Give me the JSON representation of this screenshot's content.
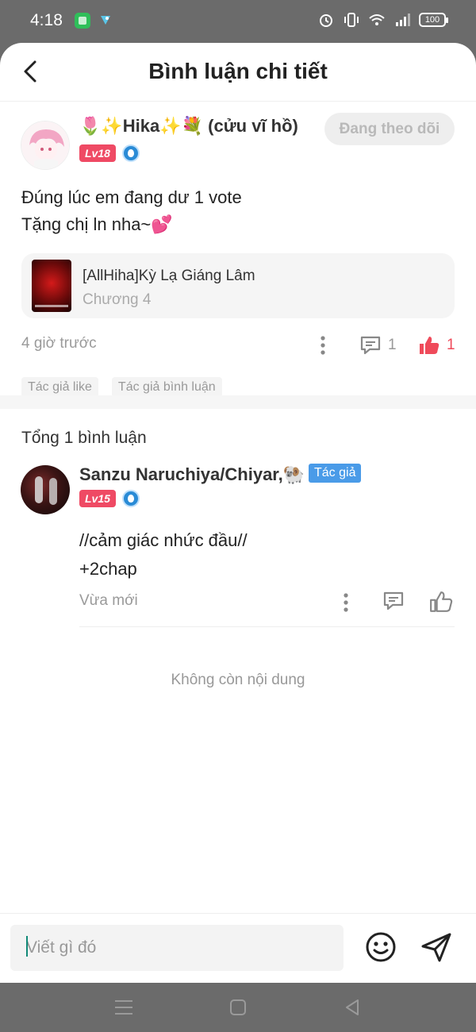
{
  "status_bar": {
    "time": "4:18",
    "battery": "100"
  },
  "header": {
    "title": "Bình luận chi tiết"
  },
  "post": {
    "user_name": "🌷✨Hika✨💐 (cửu vĩ hồ)",
    "level": "Lv18",
    "follow_label": "Đang theo dõi",
    "text_line1": "Đúng lúc em đang dư 1 vote",
    "text_line2": "Tặng chị ln nha~💕",
    "book": {
      "title": "[AllHiha]Kỳ Lạ Giáng Lâm",
      "chapter": "Chương 4"
    },
    "time": "4 giờ trước",
    "comment_count": "1",
    "like_count": "1",
    "tags": [
      "Tác giả like",
      "Tác giả bình luận"
    ]
  },
  "replies": {
    "total_label": "Tổng 1 bình luận",
    "items": [
      {
        "user_name": "Sanzu Naruchiya/Chiyar,🐏",
        "author_tag": "Tác giả",
        "level": "Lv15",
        "text_line1": "//cảm giác nhức đầu//",
        "text_line2": "+2chap",
        "time": "Vừa mới"
      }
    ],
    "end_label": "Không còn nội dung"
  },
  "composer": {
    "placeholder": "Viết gì đó"
  },
  "icons": {
    "back": "chevron-left-icon",
    "more": "more-vertical-icon",
    "comment": "comment-icon",
    "like": "thumbs-up-icon",
    "emoji": "smiley-icon",
    "send": "send-icon"
  },
  "colors": {
    "accent": "#ef4a5a",
    "author_tag": "#4a9be8",
    "level_badge": "#ef4a64"
  }
}
